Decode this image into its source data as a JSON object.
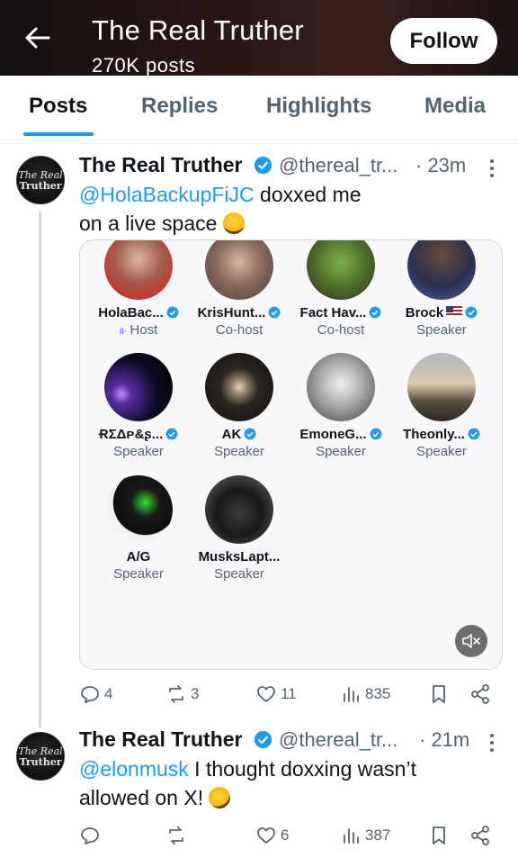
{
  "header": {
    "back_label": "back",
    "title": "The Real Truther",
    "post_count": "270K posts",
    "follow_label": "Follow",
    "colors": {
      "bg": "#1a1212",
      "text": "#ffffff"
    }
  },
  "tabs": [
    {
      "label": "Posts",
      "active": true
    },
    {
      "label": "Replies",
      "active": false
    },
    {
      "label": "Highlights",
      "active": false
    },
    {
      "label": "Media",
      "active": false
    }
  ],
  "avatar_text": {
    "line1": "The Real",
    "line2": "Truther"
  },
  "tweets": [
    {
      "name": "The Real Truther",
      "handle": "@thereal_tr...",
      "time": "· 23m",
      "mention": "@HolaBackupFiJC",
      "text_line1_after": " doxxed me",
      "text_line2": "on a live space",
      "emoji": "laughing-tears-emoji",
      "space": {
        "participants": [
          {
            "name": "HolaBac...",
            "role": "Host",
            "verified": true
          },
          {
            "name": "KrisHunt...",
            "role": "Co-host",
            "verified": true
          },
          {
            "name": "Fact Hav...",
            "role": "Co-host",
            "verified": true
          },
          {
            "name": "Brock",
            "role": "Speaker",
            "verified": true,
            "flag": "us-flag"
          },
          {
            "name": "ɌΣΔᴘ&ʂ...",
            "role": "Speaker",
            "verified": true
          },
          {
            "name": "AK",
            "role": "Speaker",
            "verified": true
          },
          {
            "name": "EmoneG...",
            "role": "Speaker",
            "verified": true
          },
          {
            "name": "Theonly...",
            "role": "Speaker",
            "verified": true
          },
          {
            "name": "A/G",
            "role": "Speaker",
            "verified": false
          },
          {
            "name": "MusksLapt...",
            "role": "Speaker",
            "verified": false
          }
        ],
        "mute_icon": "speaker-muted-icon"
      },
      "stats": {
        "replies": "4",
        "reposts": "3",
        "likes": "11",
        "views": "835"
      }
    },
    {
      "name": "The Real Truther",
      "handle": "@thereal_tr...",
      "time": "· 21m",
      "mention": "@elonmusk",
      "text_line1_after": " I thought doxxing wasn’t",
      "text_line2": "allowed on X!",
      "emoji": "rolling-laughing-emoji",
      "stats": {
        "replies": "",
        "reposts": "",
        "likes": "6",
        "views": "387"
      }
    }
  ],
  "colors": {
    "accent": "#1d9bf0",
    "muted": "#536471",
    "text": "#0f1419"
  }
}
